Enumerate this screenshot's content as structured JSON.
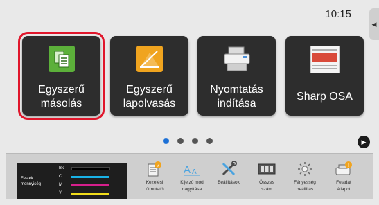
{
  "status": {
    "time": "10:15",
    "side_tab_glyph": "◀"
  },
  "tiles": [
    {
      "label_line1": "Egyszerű",
      "label_line2": "másolás",
      "icon": "copy-icon",
      "selected": true
    },
    {
      "label_line1": "Egyszerű",
      "label_line2": "lapolvasás",
      "icon": "scan-icon"
    },
    {
      "label_line1": "Nyomtatás",
      "label_line2": "indítása",
      "icon": "printer-icon"
    },
    {
      "label_line1": "Sharp OSA",
      "label_line2": "",
      "icon": "osa-icon"
    }
  ],
  "pagination": {
    "pages": 4,
    "active_index": 0,
    "next_glyph": "▶"
  },
  "toner": {
    "title_line1": "Festék",
    "title_line2": "mennyiség",
    "levels": [
      {
        "label": "Bk",
        "color": "#000000"
      },
      {
        "label": "C",
        "color": "#19b2e6"
      },
      {
        "label": "M",
        "color": "#d61f8c"
      },
      {
        "label": "Y",
        "color": "#f0dc1a"
      }
    ]
  },
  "bottom_buttons": [
    {
      "name": "operation-guide",
      "line1": "Kezelési",
      "line2": "útmutató",
      "icon": "guide-icon"
    },
    {
      "name": "display-zoom",
      "line1": "Kijelző mód",
      "line2": "nagyítása",
      "icon": "zoom-text-icon"
    },
    {
      "name": "settings",
      "line1": "Beállítások",
      "line2": "",
      "icon": "tools-icon"
    },
    {
      "name": "total-count",
      "line1": "Összes",
      "line2": "szám",
      "icon": "counter-icon"
    },
    {
      "name": "brightness",
      "line1": "Fényesség",
      "line2": "beállítás",
      "icon": "brightness-icon"
    },
    {
      "name": "job-status",
      "line1": "Feladat",
      "line2": "állapot",
      "icon": "job-status-icon"
    }
  ],
  "colors": {
    "accent_red": "#e0162b",
    "active_dot": "#1c70d6",
    "tile_bg": "#2d2d2d"
  }
}
